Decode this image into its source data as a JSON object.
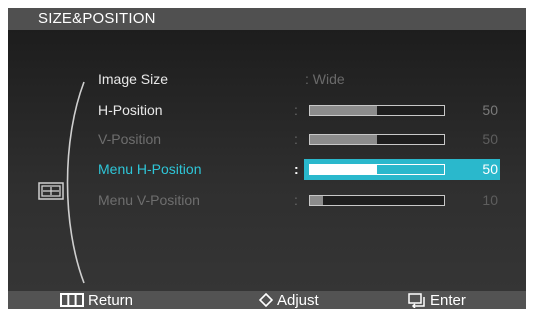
{
  "header": {
    "title": "SIZE&POSITION"
  },
  "icons": {
    "menu": "size-position-icon",
    "return": "menu-bars-icon",
    "adjust": "diamond-arrows-icon",
    "enter": "enter-icon"
  },
  "colors": {
    "accent": "#2ab8cc",
    "panel": "#2a2a2a",
    "bar_fill": "#8c8c8c"
  },
  "menu": {
    "items": [
      {
        "label": "Image Size",
        "colon": ":",
        "value": "Wide"
      },
      {
        "label": "H-Position",
        "colon": ":",
        "value": "50",
        "level": 0.5
      },
      {
        "label": "V-Position",
        "colon": ":",
        "value": "50",
        "level": 0.5
      },
      {
        "label": "Menu H-Position",
        "colon": ":",
        "value": "50",
        "level": 0.5,
        "selected": true
      },
      {
        "label": "Menu V-Position",
        "colon": ":",
        "value": "10",
        "level": 0.1
      }
    ]
  },
  "footer": {
    "return_label": "Return",
    "adjust_label": "Adjust",
    "enter_label": "Enter"
  }
}
